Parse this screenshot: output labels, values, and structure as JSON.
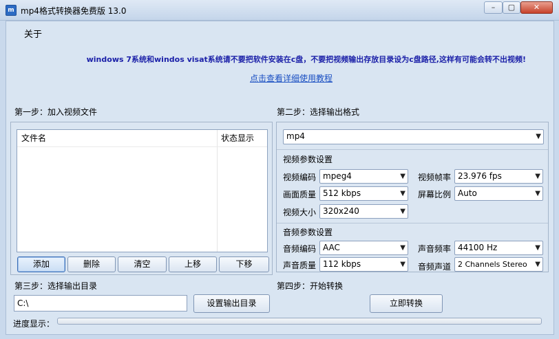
{
  "window": {
    "title": "mp4格式转换器免费版 13.0",
    "icon_name": "app-logo-icon",
    "controls": {
      "minimize": "–",
      "maximize": "▢",
      "close": "✕"
    }
  },
  "menu": {
    "about": "关于"
  },
  "notice": {
    "text": "windows 7系统和windos visat系统请不要把软件安装在c盘，不要把视频输出存放目录设为c盘路径,这样有可能会转不出视频!",
    "color": "#1a1fa8"
  },
  "help_link": "点击查看详细使用教程",
  "step1": {
    "label": "第一步：加入视频文件",
    "columns": [
      "文件名",
      "状态显示"
    ],
    "rows": [],
    "buttons": [
      "添加",
      "删除",
      "清空",
      "上移",
      "下移"
    ]
  },
  "step2": {
    "label": "第二步：选择输出格式",
    "format": "mp4",
    "video_title": "视频参数设置",
    "video": {
      "codec_label": "视频编码",
      "codec": "mpeg4",
      "framerate_label": "视频帧率",
      "framerate": "23.976 fps",
      "quality_label": "画面质量",
      "quality": "512 kbps",
      "ratio_label": "屏幕比例",
      "ratio": "Auto",
      "size_label": "视频大小",
      "size": "320x240"
    },
    "audio_title": "音频参数设置",
    "audio": {
      "codec_label": "音频编码",
      "codec": "AAC",
      "samplerate_label": "声音频率",
      "samplerate": "44100 Hz",
      "quality_label": "声音质量",
      "quality": "112 kbps",
      "channels_label": "音频声道",
      "channels": "2 Channels Stereo"
    }
  },
  "step3": {
    "label": "第三步：选择输出目录",
    "path": "C:\\",
    "button": "设置输出目录"
  },
  "step4": {
    "label": "第四步：开始转换",
    "button": "立即转换"
  },
  "progress": {
    "label": "进度显示：",
    "value": 0,
    "fill_color": "#4aa43a"
  }
}
